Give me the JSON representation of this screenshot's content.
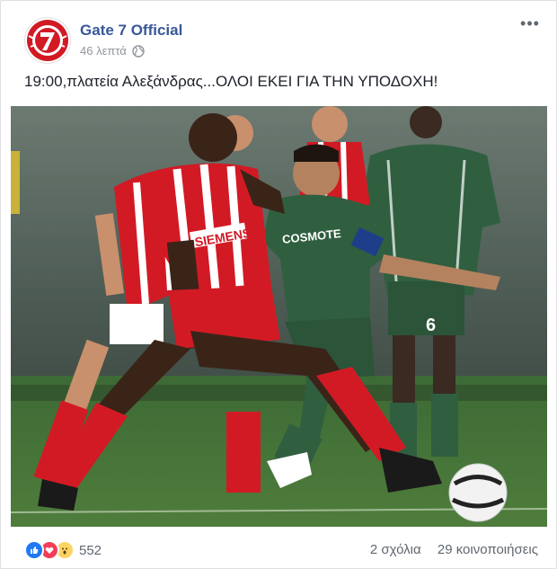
{
  "header": {
    "page_name": "Gate 7 Official",
    "timestamp": "46 λεπτά",
    "privacy_icon": "globe-icon",
    "more_icon": "ellipsis-icon",
    "more_label": "•••"
  },
  "post": {
    "text": "19:00,πλατεία Αλεξάνδρας...ΟΛΟΙ ΕΚΕΙ ΓΙΑ ΤΗΝ ΥΠΟΔΟΧΗ!",
    "photo": {
      "sponsor_red": "SIEMENS",
      "sponsor_green": "COSMOTE",
      "number_green": "6"
    }
  },
  "footer": {
    "reaction_icons": [
      "like-icon",
      "love-icon",
      "wow-icon"
    ],
    "reaction_count": "552",
    "comments": "2 σχόλια",
    "shares": "29 κοινοποιήσεις"
  },
  "colors": {
    "link": "#385898",
    "muted": "#606770",
    "olympiacos_red": "#d21a25",
    "panathinaikos_green": "#2f5f3f"
  }
}
